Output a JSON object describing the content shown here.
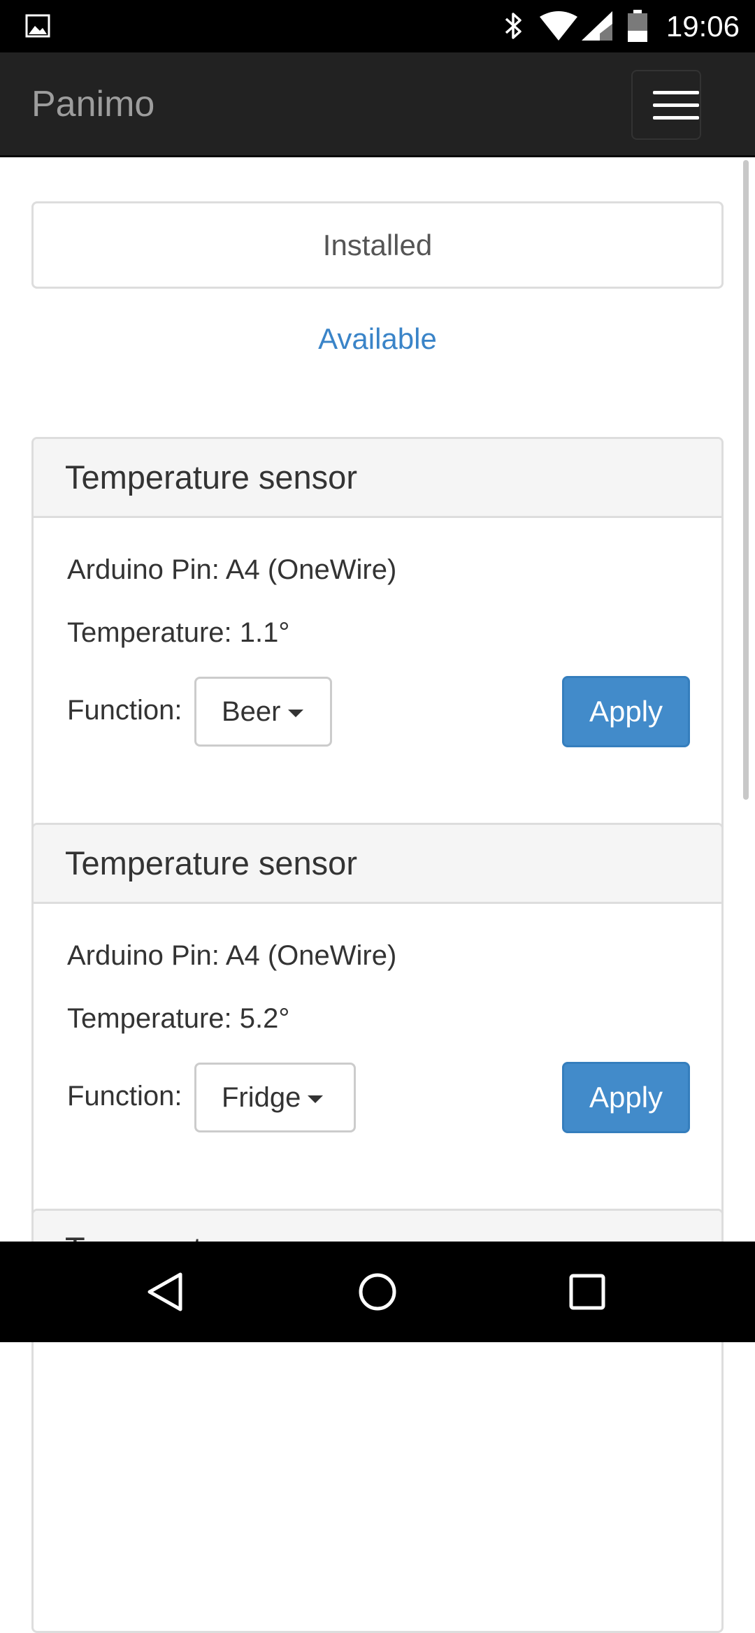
{
  "status_bar": {
    "time": "19:06",
    "icons": [
      "gallery-icon",
      "bluetooth-icon",
      "wifi-icon",
      "signal-icon",
      "battery-icon"
    ]
  },
  "navbar": {
    "brand": "Panimo",
    "menu_icon": "hamburger-icon"
  },
  "tabs": {
    "installed": "Installed",
    "available": "Available"
  },
  "panels": [
    {
      "title": "Temperature sensor",
      "pin": "Arduino Pin: A4 (OneWire)",
      "temperature": "Temperature: 1.1°",
      "function_label": "Function:",
      "function_value": "Beer",
      "apply_label": "Apply"
    },
    {
      "title": "Temperature sensor",
      "pin": "Arduino Pin: A4 (OneWire)",
      "temperature": "Temperature: 5.2°",
      "function_label": "Function:",
      "function_value": "Fridge",
      "apply_label": "Apply"
    },
    {
      "title": "Temperature sensor"
    }
  ],
  "colors": {
    "navbar_bg": "#222222",
    "brand_text": "#9d9d9d",
    "link": "#3a84c8",
    "primary_button": "#428bca",
    "panel_heading_bg": "#f5f5f5",
    "border": "#dddddd"
  },
  "android_nav": {
    "icons": [
      "back-icon",
      "home-icon",
      "recents-icon"
    ]
  }
}
